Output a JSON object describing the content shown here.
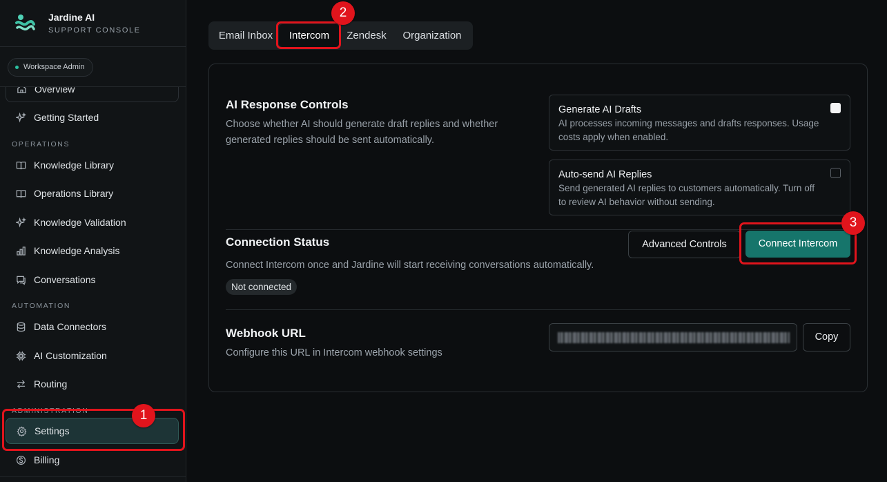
{
  "brand": {
    "name": "Jardine AI",
    "subtitle": "SUPPORT CONSOLE"
  },
  "sidebar": {
    "role_badge": "Workspace Admin",
    "items": [
      {
        "label": "Overview",
        "icon": "home-icon"
      },
      {
        "label": "Getting Started",
        "icon": "sparkle-icon"
      },
      {
        "label": "Knowledge Library",
        "icon": "book-icon"
      },
      {
        "label": "Operations Library",
        "icon": "book-icon"
      },
      {
        "label": "Knowledge Validation",
        "icon": "sparkle-icon"
      },
      {
        "label": "Knowledge Analysis",
        "icon": "bar-chart-icon"
      },
      {
        "label": "Conversations",
        "icon": "chat-icon"
      },
      {
        "label": "Data Connectors",
        "icon": "database-icon"
      },
      {
        "label": "AI Customization",
        "icon": "chip-icon"
      },
      {
        "label": "Routing",
        "icon": "arrows-icon"
      },
      {
        "label": "Settings",
        "icon": "gear-icon"
      },
      {
        "label": "Billing",
        "icon": "dollar-icon"
      }
    ],
    "sections": {
      "operations": "OPERATIONS",
      "automation": "AUTOMATION",
      "administration": "ADMINISTRATION"
    },
    "active_item": "Settings"
  },
  "tabs": {
    "items": [
      "Email Inbox",
      "Intercom",
      "Zendesk",
      "Organization"
    ],
    "active": "Intercom"
  },
  "ai_controls": {
    "title": "AI Response Controls",
    "description": "Choose whether AI should generate draft replies and whether generated replies should be sent automatically.",
    "options": [
      {
        "title": "Generate AI Drafts",
        "description": "AI processes incoming messages and drafts responses. Usage costs apply when enabled.",
        "checked": true
      },
      {
        "title": "Auto-send AI Replies",
        "description": "Send generated AI replies to customers automatically. Turn off to review AI behavior without sending.",
        "checked": false
      }
    ]
  },
  "connection": {
    "title": "Connection Status",
    "description": "Connect Intercom once and Jardine will start receiving conversations automatically.",
    "status": "Not connected",
    "advanced_label": "Advanced Controls",
    "connect_label": "Connect Intercom"
  },
  "webhook": {
    "title": "Webhook URL",
    "description": "Configure this URL in Intercom webhook settings",
    "copy_label": "Copy"
  },
  "annotations": [
    "1",
    "2",
    "3"
  ],
  "colors": {
    "accent": "#16756b",
    "highlight": "#e1141c",
    "active_nav": "#1d3436"
  }
}
